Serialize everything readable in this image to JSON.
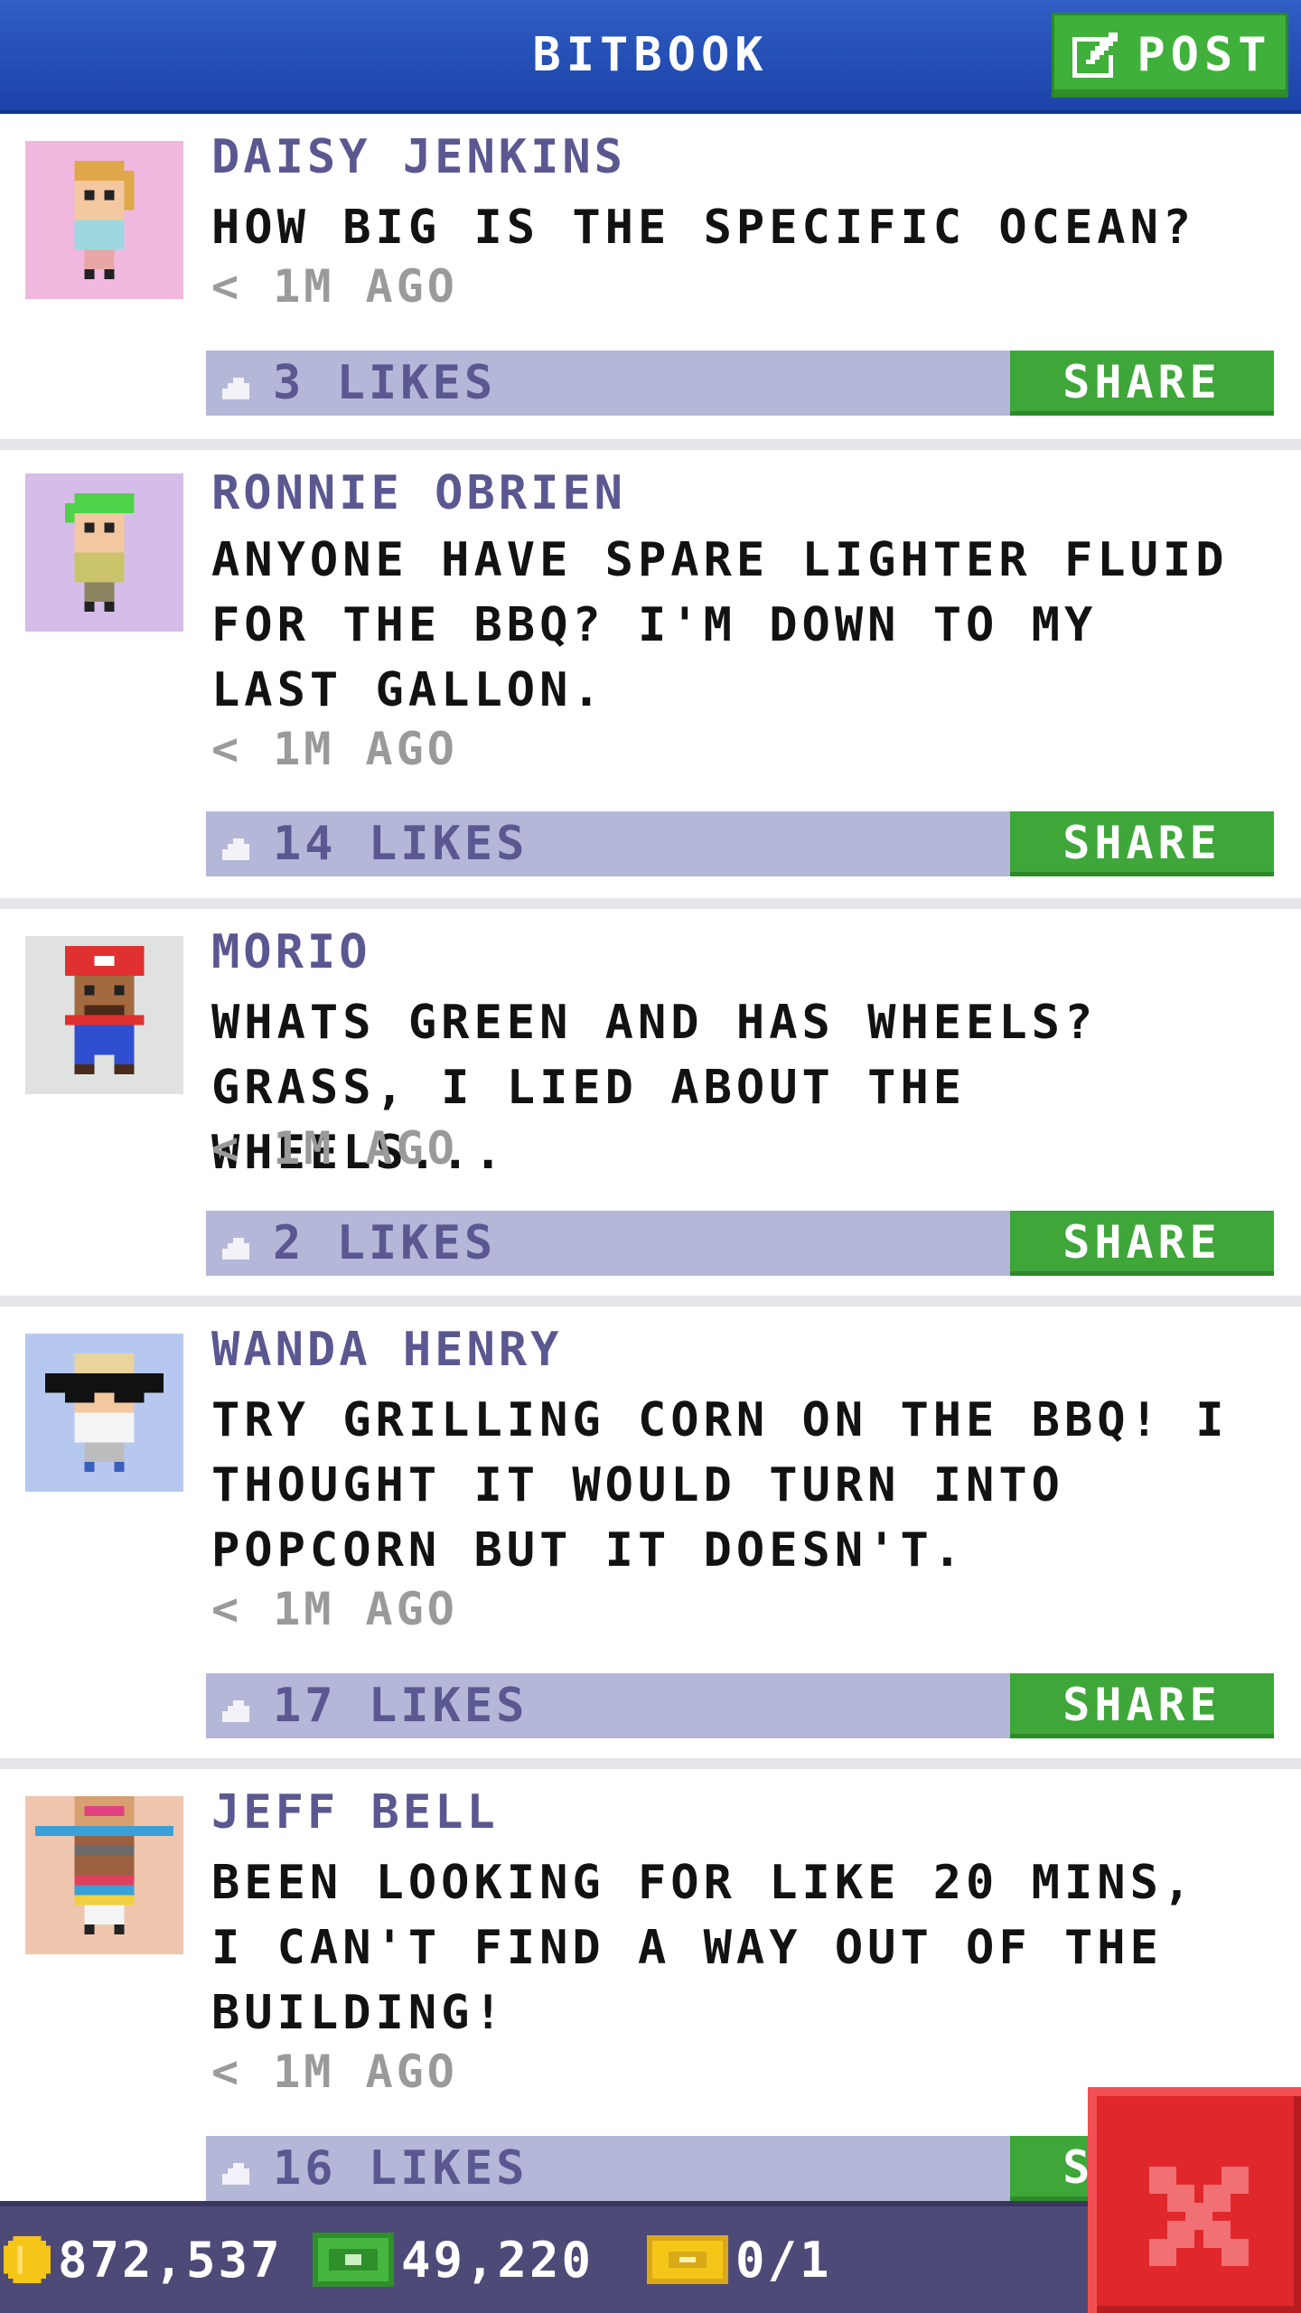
{
  "app": {
    "title": "BITBOOK",
    "post_label": "POST",
    "colors": {
      "header_blue": "#2250b8",
      "button_green": "#3fa63a",
      "author_purple": "#5b5790",
      "like_bar": "#b4b7d8",
      "close_red": "#e0282c"
    }
  },
  "posts": [
    {
      "author": "DAISY JENKINS",
      "text": "HOW BIG IS THE SPECIFIC OCEAN?",
      "time": "< 1M AGO",
      "likes": "3 LIKES",
      "share": "SHARE",
      "avatar_bg": "#f0b8de"
    },
    {
      "author": "RONNIE OBRIEN",
      "text": "ANYONE HAVE SPARE LIGHTER FLUID FOR THE BBQ? I'M DOWN TO MY LAST GALLON.",
      "time": "< 1M AGO",
      "likes": "14 LIKES",
      "share": "SHARE",
      "avatar_bg": "#d6bce8"
    },
    {
      "author": "MORIO",
      "text": "WHATS GREEN AND HAS WHEELS? GRASS, I LIED ABOUT THE WHEELS...",
      "time": "< 1M AGO",
      "likes": "2 LIKES",
      "share": "SHARE",
      "avatar_bg": "#dfe2e0"
    },
    {
      "author": "WANDA HENRY",
      "text": "TRY GRILLING CORN ON THE BBQ! I THOUGHT IT WOULD TURN INTO POPCORN BUT IT DOESN'T.",
      "time": "< 1M AGO",
      "likes": "17 LIKES",
      "share": "SHARE",
      "avatar_bg": "#b7c8f0"
    },
    {
      "author": "JEFF BELL",
      "text": "BEEN LOOKING FOR LIKE 20 MINS, I CAN'T FIND A WAY OUT OF THE BUILDING!",
      "time": "< 1M AGO",
      "likes": "16 LIKES",
      "share": "SHARE",
      "avatar_bg": "#eec6ae"
    }
  ],
  "status": {
    "coins": "872,537",
    "bux": "49,220",
    "tickets": "0/1"
  },
  "icons": {
    "post": "edit-icon",
    "like": "thumbs-up-icon",
    "coin": "coin-icon",
    "bux": "cash-icon",
    "ticket": "ticket-icon",
    "close": "close-icon"
  }
}
